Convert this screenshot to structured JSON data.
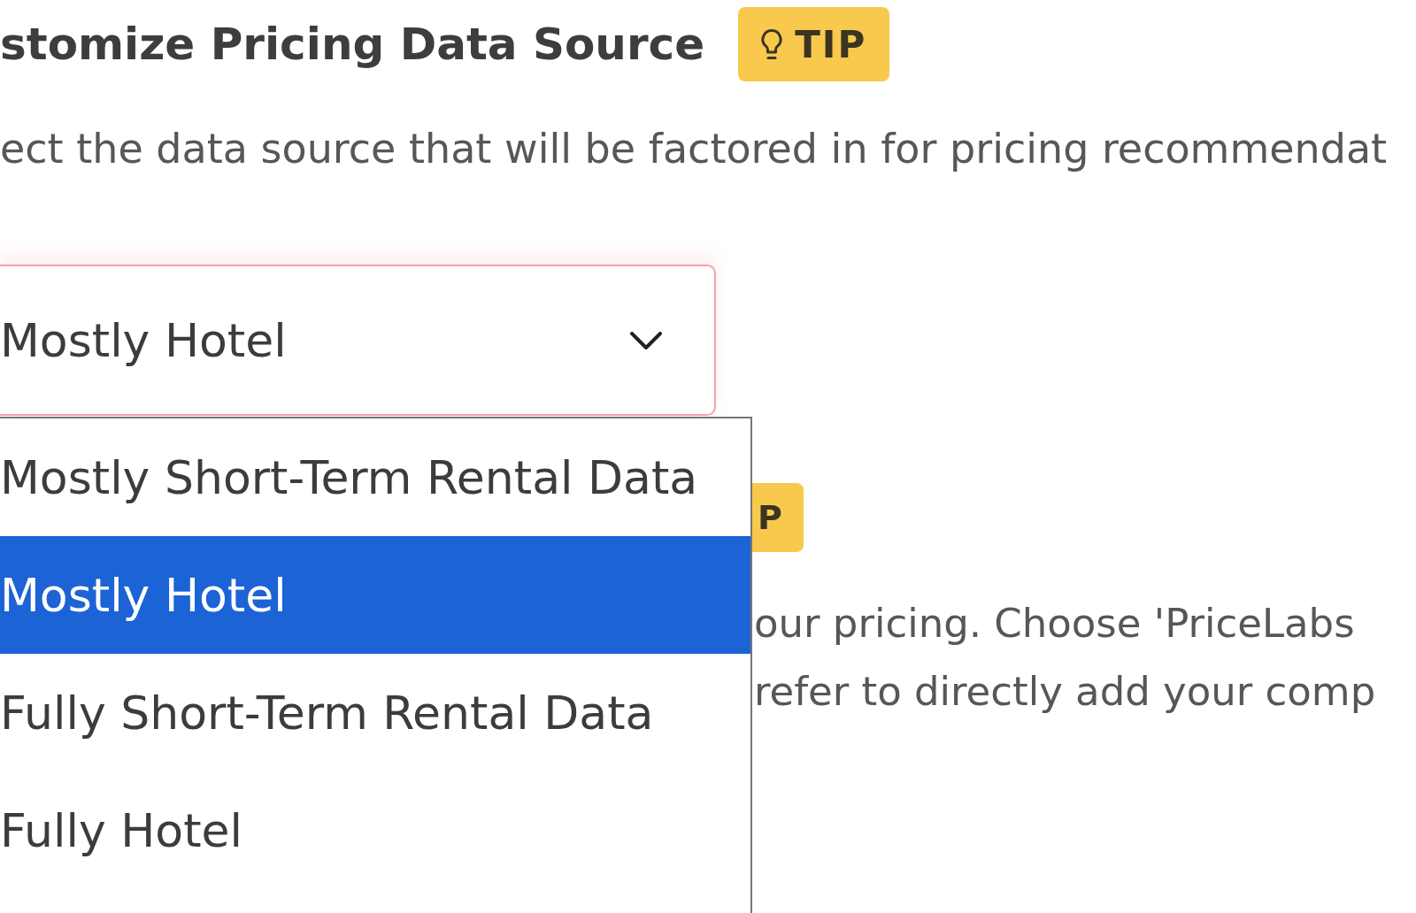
{
  "header": {
    "title": "stomize Pricing Data Source",
    "badge": "TIP",
    "description": "ect the data source that will be factored in for pricing recommendat"
  },
  "select": {
    "value": "Mostly Hotel",
    "focused": true,
    "expanded": true,
    "options": [
      {
        "label": "Mostly Short-Term Rental Data",
        "selected": false
      },
      {
        "label": "Mostly Hotel",
        "selected": true
      },
      {
        "label": "Fully Short-Term Rental Data",
        "selected": false
      },
      {
        "label": "Fully Hotel",
        "selected": false
      }
    ]
  },
  "next_section": {
    "badge": "P",
    "lines": [
      "our pricing. Choose 'PriceLabs",
      "refer to directly add your comp"
    ]
  }
}
